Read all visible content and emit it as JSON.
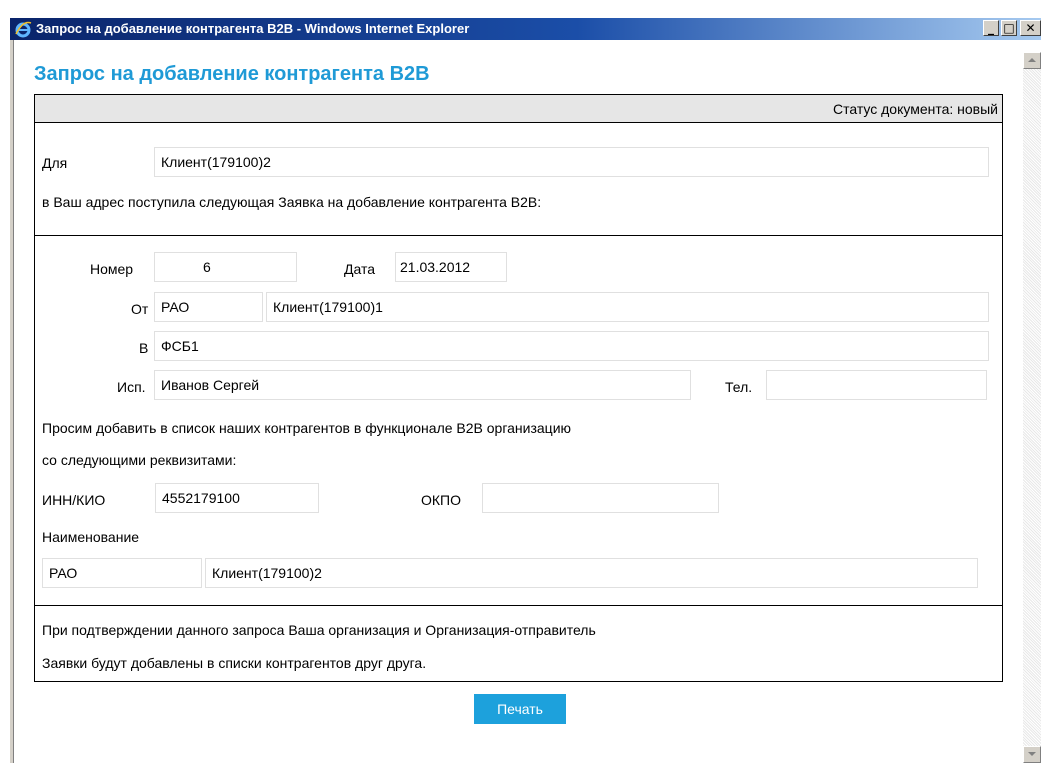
{
  "window": {
    "title": "Запрос на добавление контрагента B2B - Windows Internet Explorer",
    "min_glyph": "_",
    "max_glyph": "□",
    "close_glyph": "✕"
  },
  "page": {
    "heading": "Запрос на добавление контрагента B2B",
    "status_text": "Статус документа: новый"
  },
  "recipient": {
    "label": "Для",
    "value": "Клиент(179100)2",
    "intro_text": "в Ваш адрес поступила следующая Заявка на добавление контрагента B2B:"
  },
  "request": {
    "number_label": "Номер",
    "number_value": "6",
    "date_label": "Дата",
    "date_value": "21.03.2012",
    "from_label": "От",
    "from_type": "РАО",
    "from_name": "Клиент(179100)1",
    "to_label": "В",
    "to_value": "ФСБ1",
    "executor_label": "Исп.",
    "executor_value": "Иванов Сергей",
    "phone_label": "Тел.",
    "phone_value": "",
    "request_text_1": "Просим добавить в список наших контрагентов в функционале B2B организацию",
    "request_text_2": "со следующими реквизитами:",
    "inn_label": "ИНН/КИО",
    "inn_value": "4552179100",
    "okpo_label": "ОКПО",
    "okpo_value": "",
    "name_label": "Наименование",
    "name_type": "РАО",
    "name_value": "Клиент(179100)2"
  },
  "footer": {
    "note_1": "При подтверждении данного запроса Ваша организация и Организация-отправитель",
    "note_2": "Заявки будут добавлены в списки контрагентов друг друга."
  },
  "print_button": {
    "label": "Печать",
    "color": "#1da1dc"
  },
  "icons": [
    "ie-icon",
    "minimize-icon",
    "maximize-icon",
    "close-icon",
    "scroll-up-icon",
    "scroll-down-icon"
  ],
  "colors": {
    "heading": "#1f9ad6",
    "titlebar": "#0a246a"
  }
}
